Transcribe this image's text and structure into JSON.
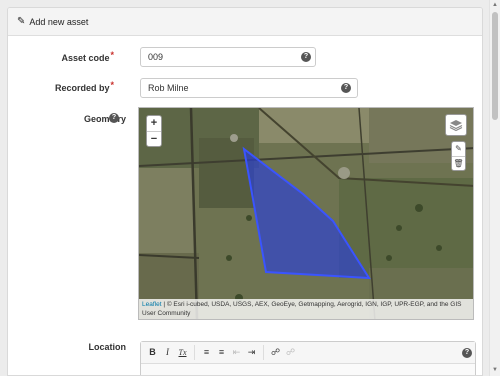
{
  "header": {
    "title": "Add new asset",
    "icon": "pencil-icon"
  },
  "form": {
    "asset_code": {
      "label": "Asset code",
      "required_mark": "*",
      "value": "009"
    },
    "recorded_by": {
      "label": "Recorded by",
      "required_mark": "*",
      "value": "Rob Milne"
    },
    "geometry": {
      "label": "Geometry"
    },
    "location": {
      "label": "Location"
    }
  },
  "map": {
    "zoom_in": "+",
    "zoom_out": "−",
    "attribution_link": "Leaflet",
    "attribution_text": " | © Esri i-cubed, USDA, USGS, AEX, GeoEye, Getmapping, Aerogrid, IGN, IGP, UPR-EGP, and the GIS User Community",
    "polygon_color": "#2a3fd8"
  },
  "editor": {
    "toolbar": [
      "bold",
      "italic",
      "remove-format",
      "numbered-list",
      "bulleted-list",
      "outdent",
      "indent",
      "link",
      "unlink"
    ],
    "bold": "B",
    "italic": "I",
    "clear_format": "Tx"
  },
  "help_glyph": "?"
}
